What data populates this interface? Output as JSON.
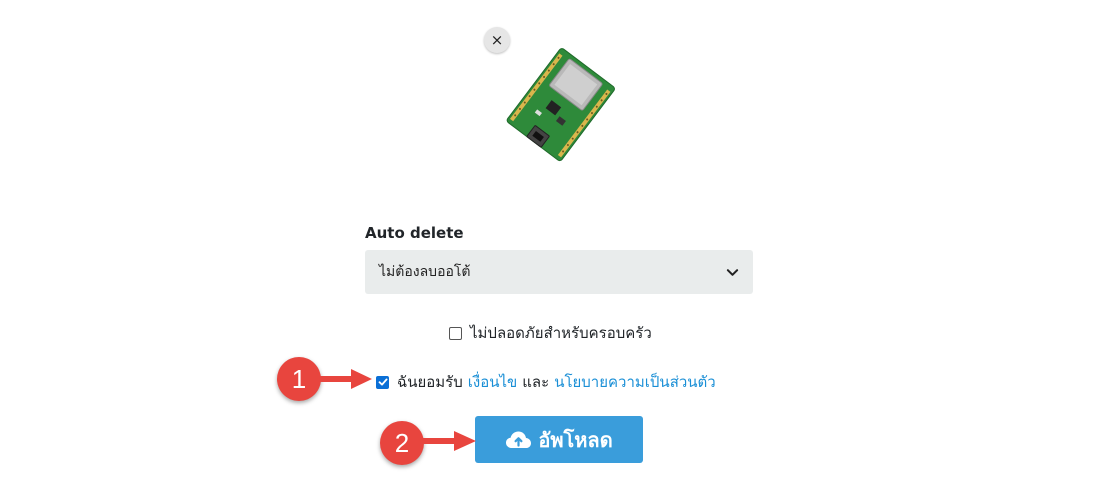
{
  "preview": {
    "remove_label": "×",
    "image_icon": "esp32-board-icon"
  },
  "auto_delete": {
    "label": "Auto delete",
    "selected": "ไม่ต้องลบออโต้"
  },
  "unsafe_checkbox": {
    "label": "ไม่ปลอดภัยสำหรับครอบครัว",
    "checked": false
  },
  "agree_checkbox": {
    "checked": true,
    "prefix": "ฉันยอมรับ",
    "terms_link": "เงื่อนไข",
    "conjunction": "และ",
    "privacy_link": "นโยบายความเป็นส่วนตัว"
  },
  "upload_button": {
    "label": "อัพโหลด",
    "icon": "cloud-upload-icon"
  },
  "annotations": {
    "badge_1": "1",
    "badge_2": "2",
    "badge_color": "#e8453e"
  },
  "colors": {
    "link": "#1a8fd6",
    "button": "#3a9ddb",
    "checkbox": "#0a6fd6"
  }
}
